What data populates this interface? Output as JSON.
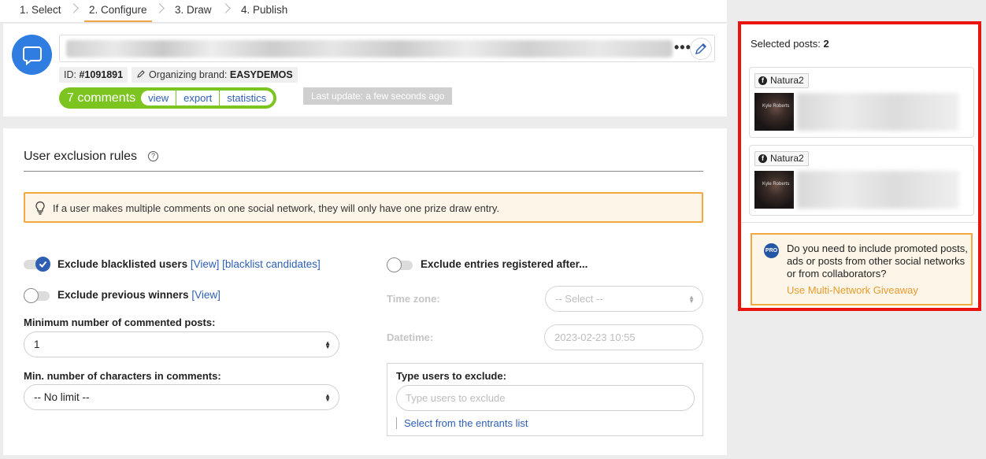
{
  "steps": [
    {
      "label": "1. Select"
    },
    {
      "label": "2. Configure"
    },
    {
      "label": "3. Draw"
    },
    {
      "label": "4. Publish"
    }
  ],
  "header": {
    "id_label": "ID:",
    "id_value": "#1091891",
    "brand_label": "Organizing brand:",
    "brand_value": "EASYDEMOS",
    "comments_count": "7 comments",
    "links": {
      "view": "view",
      "export": "export",
      "statistics": "statistics"
    },
    "last_update": "Last update: a few seconds ago",
    "more_label": "•••"
  },
  "rules": {
    "title": "User exclusion rules",
    "help": "?",
    "notice": "If a user makes multiple comments on one social network, they will only have one prize draw entry.",
    "blacklist_label": "Exclude blacklisted users",
    "blacklist_view": "[View]",
    "blacklist_candidates": "[blacklist candidates]",
    "winners_label": "Exclude previous winners",
    "winners_view": "[View]",
    "min_posts_label": "Minimum number of commented posts:",
    "min_posts_value": "1",
    "min_chars_label": "Min. number of characters in comments:",
    "min_chars_value": "-- No limit --",
    "after_label": "Exclude entries registered after...",
    "timezone_label": "Time zone:",
    "timezone_value": "-- Select --",
    "datetime_label": "Datetime:",
    "datetime_value": "2023-02-23 10:55",
    "type_users_label": "Type users to exclude:",
    "type_users_placeholder": "Type users to exclude",
    "entrants_link": "Select from the entrants list"
  },
  "panel": {
    "selected_label": "Selected posts:",
    "selected_count": "2",
    "posts": [
      {
        "network": "Natura2",
        "thumb_text": "Kyle Roberts"
      },
      {
        "network": "Natura2",
        "thumb_text": "Kyle Roberts"
      }
    ],
    "pro_badge": "PRO",
    "pro_text": "Do you need to include promoted posts, ads or posts from other social networks or from collaborators?",
    "pro_link": "Use Multi-Network Giveaway"
  },
  "colors": {
    "accent": "#2e5fb5",
    "green": "#7cc420",
    "orange": "#f3a840",
    "highlight": "#e8140d"
  }
}
